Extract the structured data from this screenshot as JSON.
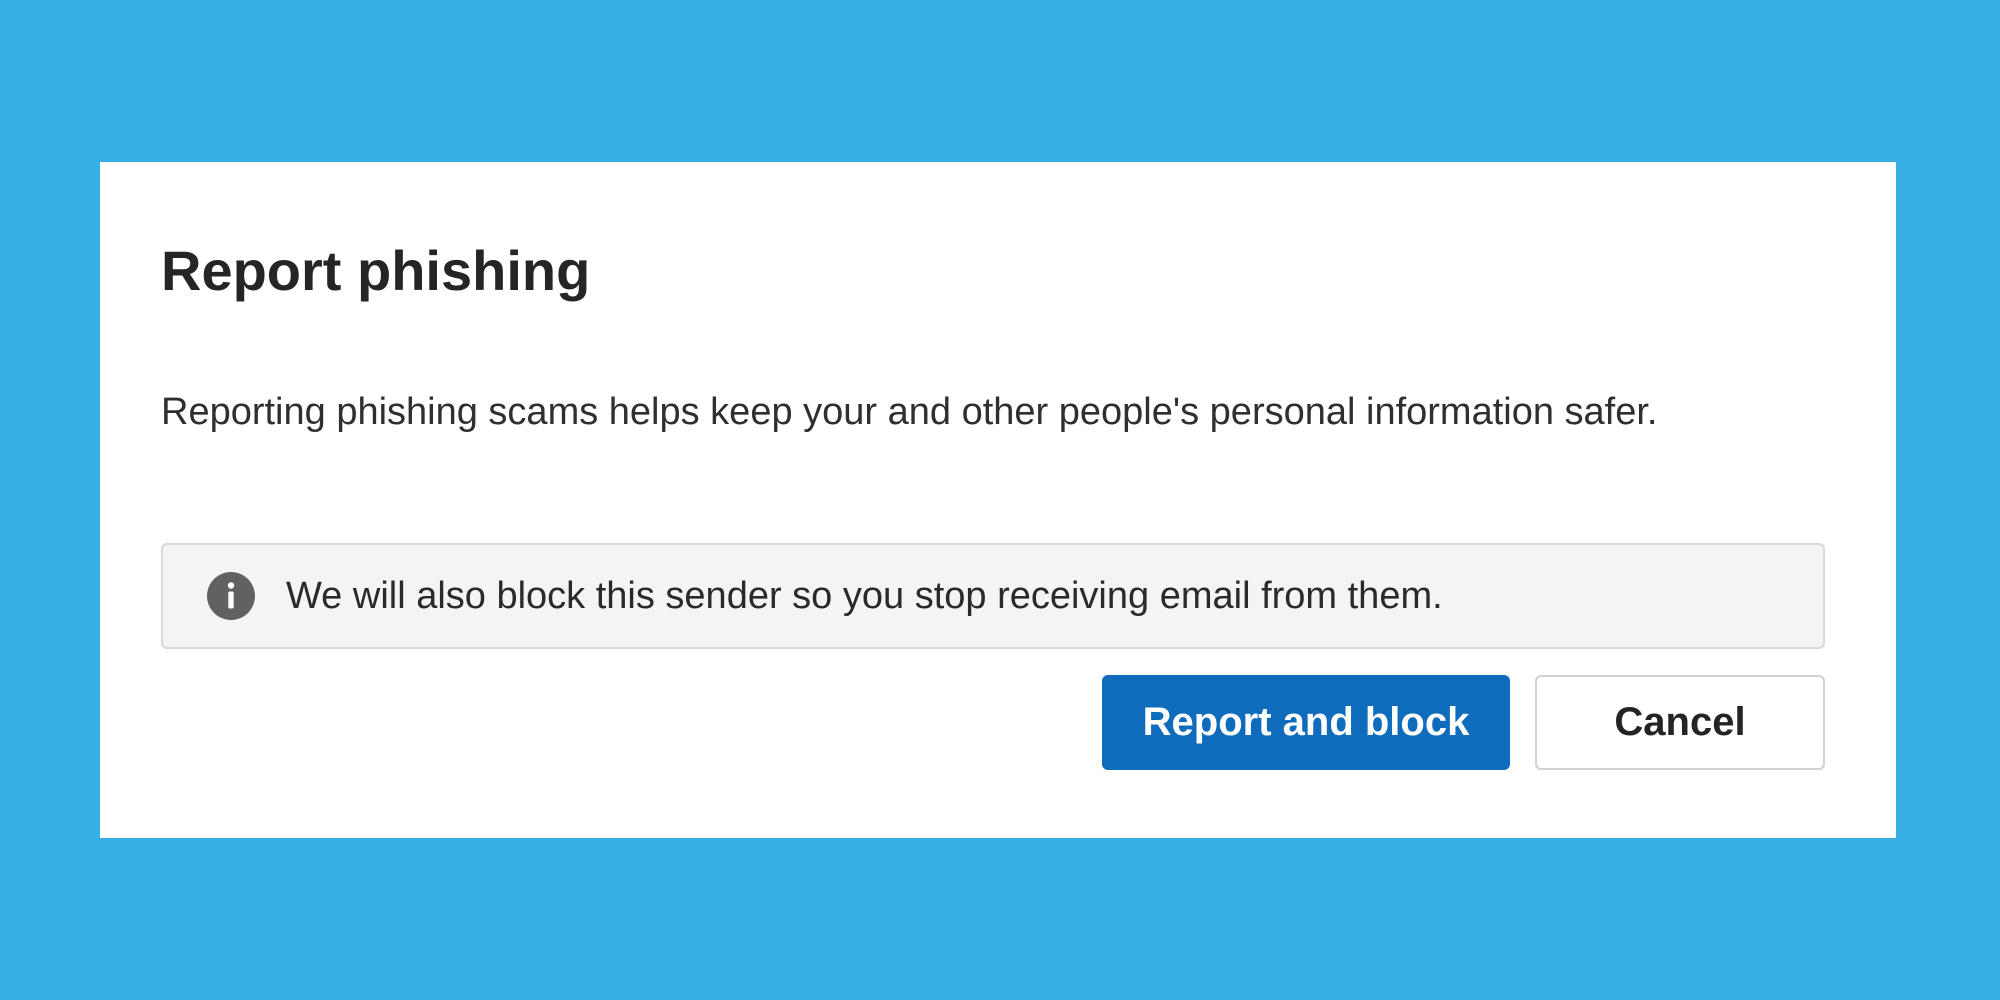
{
  "colors": {
    "background": "#35AEE4",
    "dialog": "#FFFFFF",
    "primary": "#0F6CBD",
    "info_bar": "#F4F4F4",
    "info_icon": "#616161"
  },
  "dialog": {
    "title": "Report phishing",
    "description": "Reporting phishing scams helps keep your and other people's personal information safer.",
    "info": {
      "icon": "info-icon",
      "text": "We will also block this sender so you stop receiving email from them."
    },
    "buttons": {
      "primary_label": "Report and block",
      "secondary_label": "Cancel"
    }
  }
}
